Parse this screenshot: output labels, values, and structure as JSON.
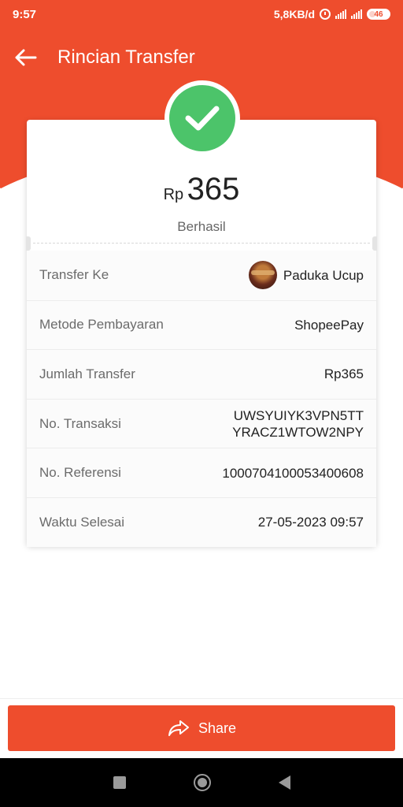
{
  "status_bar": {
    "time": "9:57",
    "net_speed": "5,8KB/d",
    "battery": "46",
    "lte_label": "4G"
  },
  "header": {
    "title": "Rincian Transfer",
    "back_icon": "arrow-left-icon",
    "color": "#ee4d2d"
  },
  "summary": {
    "status_icon": "check-icon",
    "currency": "Rp",
    "amount": "365",
    "status": "Berhasil",
    "success_color": "#4cc46a"
  },
  "details": {
    "transfer_to": {
      "label": "Transfer Ke",
      "value": "Paduka Ucup"
    },
    "payment_method": {
      "label": "Metode Pembayaran",
      "value": "ShopeePay"
    },
    "amount": {
      "label": "Jumlah Transfer",
      "value": "Rp365"
    },
    "transaction_no": {
      "label": "No. Transaksi",
      "line1": "UWSYUIYK3VPN5TT",
      "line2": "YRACZ1WTOW2NPY"
    },
    "reference_no": {
      "label": "No. Referensi",
      "value": "1000704100053400608"
    },
    "completed_time": {
      "label": "Waktu Selesai",
      "value": "27-05-2023 09:57"
    }
  },
  "actions": {
    "share_label": "Share",
    "share_icon": "share-icon"
  }
}
